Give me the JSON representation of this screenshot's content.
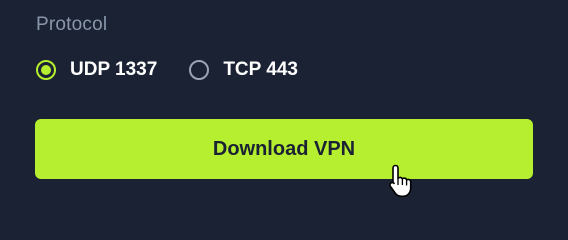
{
  "colors": {
    "background": "#1a2233",
    "accent": "#b5ef2f",
    "label_text": "#8a97ab",
    "option_text": "#ffffff",
    "unselected_ring": "#9aa4b3",
    "button_text": "#1a2233"
  },
  "protocol": {
    "label": "Protocol",
    "options": [
      {
        "label": "UDP 1337",
        "selected": true
      },
      {
        "label": "TCP 443",
        "selected": false
      }
    ]
  },
  "download": {
    "label": "Download VPN"
  },
  "cursor": {
    "icon": "hand-pointer-icon"
  }
}
